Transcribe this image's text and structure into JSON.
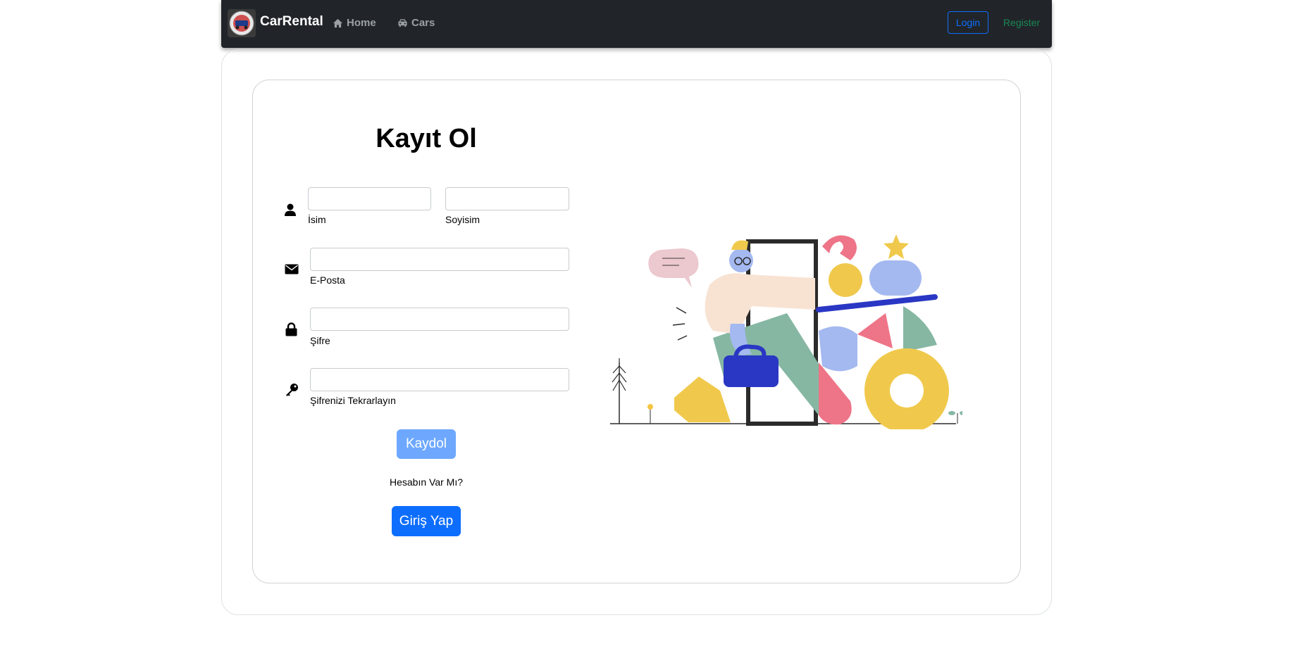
{
  "navbar": {
    "brand": "CarRental",
    "links": [
      {
        "label": "Home",
        "icon": "home-icon"
      },
      {
        "label": "Cars",
        "icon": "car-icon"
      }
    ],
    "login_label": "Login",
    "register_label": "Register"
  },
  "form": {
    "title": "Kayıt Ol",
    "fields": {
      "first_name": {
        "label": "İsim",
        "value": "",
        "icon": "user-icon"
      },
      "last_name": {
        "label": "Soyisim",
        "value": ""
      },
      "email": {
        "label": "E-Posta",
        "value": "",
        "icon": "envelope-icon"
      },
      "password": {
        "label": "Şifre",
        "value": "",
        "icon": "lock-icon"
      },
      "password_repeat": {
        "label": "Şifrenizi Tekrarlayın",
        "value": "",
        "icon": "key-icon"
      }
    },
    "submit_label": "Kaydol",
    "has_account_text": "Hesabın Var Mı?",
    "login_button_label": "Giriş Yap"
  },
  "colors": {
    "navbar_bg": "#212529",
    "primary": "#0d6efd",
    "primary_disabled": "#6ea8fe",
    "success": "#198754"
  }
}
